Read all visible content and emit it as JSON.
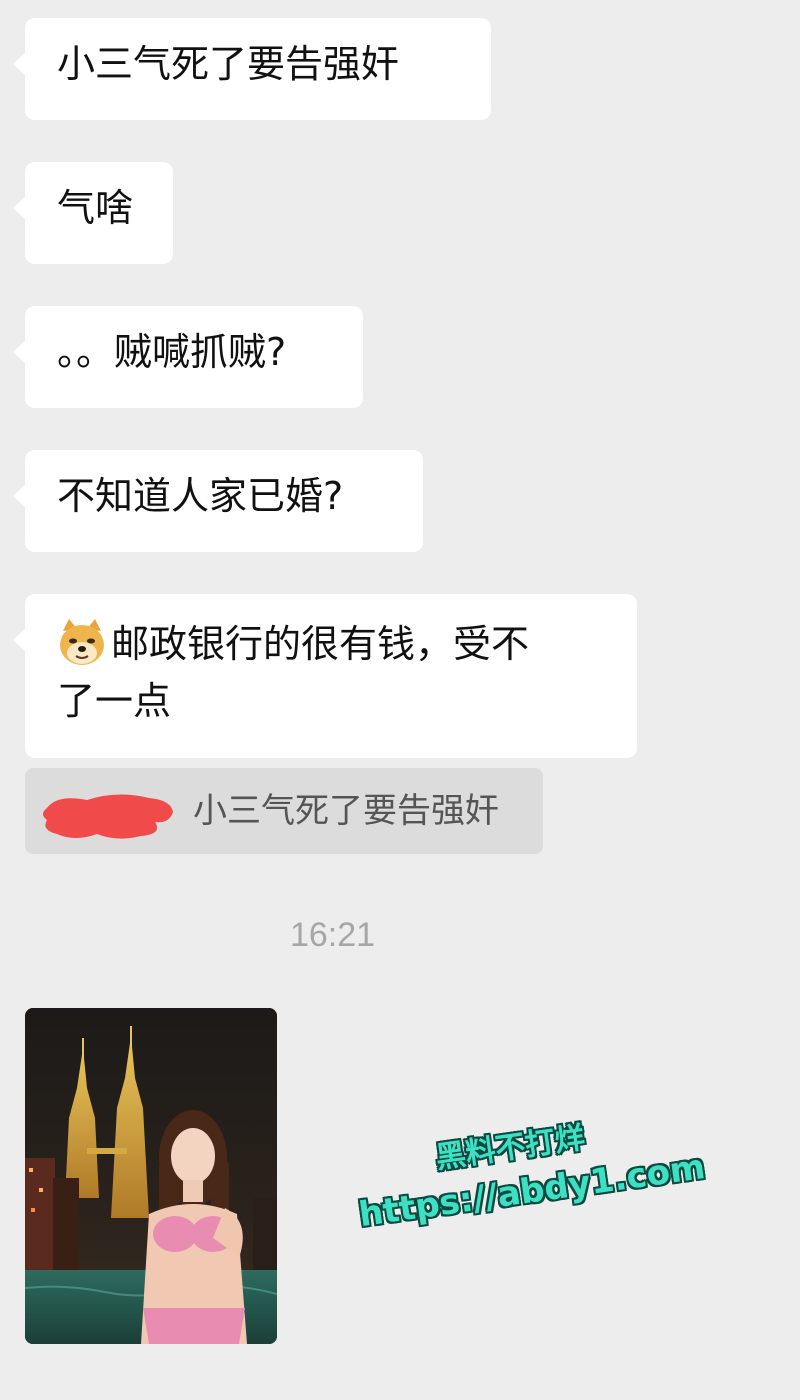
{
  "messages": [
    {
      "text": "小三气死了要告强奸"
    },
    {
      "text": "气啥"
    },
    {
      "text": "。。贼喊抓贼?"
    },
    {
      "text": "不知道人家已婚?"
    },
    {
      "line1": "邮政银行的很有钱，受不",
      "line2": "了一点",
      "emoji": "doge-emoji"
    }
  ],
  "quote": {
    "text": "小三气死了要告强奸",
    "sender_redacted": true
  },
  "timestamp": "16:21",
  "image_message": {
    "description_icon": "photo-thumbnail"
  },
  "watermark": {
    "line1": "黑料不打烊",
    "line2": "https://abdy1.com"
  },
  "colors": {
    "background": "#ededed",
    "bubble": "#ffffff",
    "quote_bg": "#dcdcdc",
    "timestamp": "#a6a6a6",
    "watermark": "#3ee0c4",
    "redact": "#f04a4a"
  }
}
